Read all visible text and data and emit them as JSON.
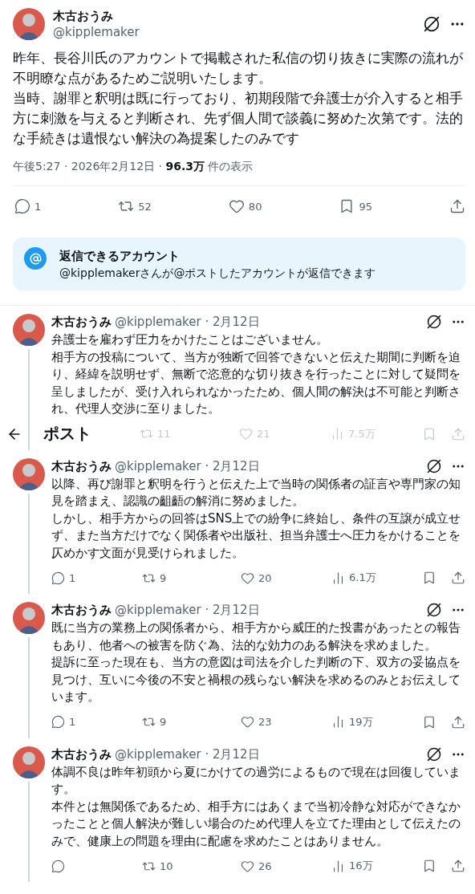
{
  "post": {
    "name": "木古おうみ",
    "handle": "@kipplemaker",
    "paragraphs": [
      "昨年、長谷川氏のアカウントで掲載された私信の切り抜きに実際の流れが不明瞭な点があるためご説明いたします。",
      "当時、謝罪と釈明は既に行っており、初期段階で弁護士が介入すると相手方に刺激を与えると判断され、先ず個人間で談義に努めた次第です。法的な手続きは遺恨ない解決の為提案したのみです"
    ],
    "meta": "午後5:27 · 2026年2月12日 · **96.3万** 件の表示",
    "actions": {
      "replies": "1",
      "reposts": "52",
      "likes": "80",
      "bookmarks": "95"
    }
  },
  "notice": {
    "title": "返信できるアカウント",
    "text": "@kipplemakerさんが@ポストしたアカウントが返信できます"
  },
  "header": {
    "title": "ポスト"
  },
  "replies": [
    {
      "name": "木古おうみ",
      "handle": "@kipplemaker · 2月12日",
      "paragraphs": [
        "弁護士を雇わず圧力をかけたことはございません。",
        "相手方の投稿について、当方が独断で回答できないと伝えた期間に判断を迫り、経緯を説明せず、無断で恣意的な切り抜きを行ったことに対して疑問を呈しましたが、受け入れられなかったため、個人間の解決は不可能と判断され、代理人交渉に至りました。"
      ],
      "under_header": true,
      "actions": {
        "reposts": "11",
        "likes": "21",
        "views": "7.5万"
      }
    },
    {
      "name": "木古おうみ",
      "handle": "@kipplemaker · 2月12日",
      "paragraphs": [
        "以降、再び謝罪と釈明を行うと伝えた上で当時の関係者の証言や専門家の知見を踏まえ、認識の齟齬の解消に努めました。",
        "しかし、相手方からの回答はSNS上での紛争に終始し、条件の互譲が成立せず、また当方だけでなく関係者や出版社、担当弁護士へ圧力をかけることを仄めかす文面が見受けられました。"
      ],
      "under_header": false,
      "actions": {
        "replies": "1",
        "reposts": "9",
        "likes": "20",
        "views": "6.1万"
      }
    },
    {
      "name": "木古おうみ",
      "handle": "@kipplemaker · 2月12日",
      "paragraphs": [
        "既に当方の業務上の関係者から、相手方から威圧的た投書があったとの報告もあり、他者への被害を防ぐ為、法的な効力のある解決を求めました。",
        "提訴に至った現在も、当方の意図は司法を介した判断の下、双方の妥協点を見つけ、互いに今後の不安と禍根の残らない解決を求めるのみとお伝えしています。"
      ],
      "under_header": false,
      "actions": {
        "replies": "1",
        "reposts": "9",
        "likes": "23",
        "views": "19万"
      }
    },
    {
      "name": "木古おうみ",
      "handle": "@kipplemaker · 2月12日",
      "paragraphs": [
        "体調不良は昨年初頭から夏にかけての過労によるもので現在は回復しています。",
        "本件とは無関係であるため、相手方にはあくまで当初冷静な対応ができなかったことと個人解決が難しい場合のため代理人を立てた理由として伝えたのみで、健康上の問題を理由に配慮を求めたことはありません。"
      ],
      "under_header": false,
      "actions": {
        "reposts": "10",
        "likes": "26",
        "views": "16万"
      }
    }
  ]
}
